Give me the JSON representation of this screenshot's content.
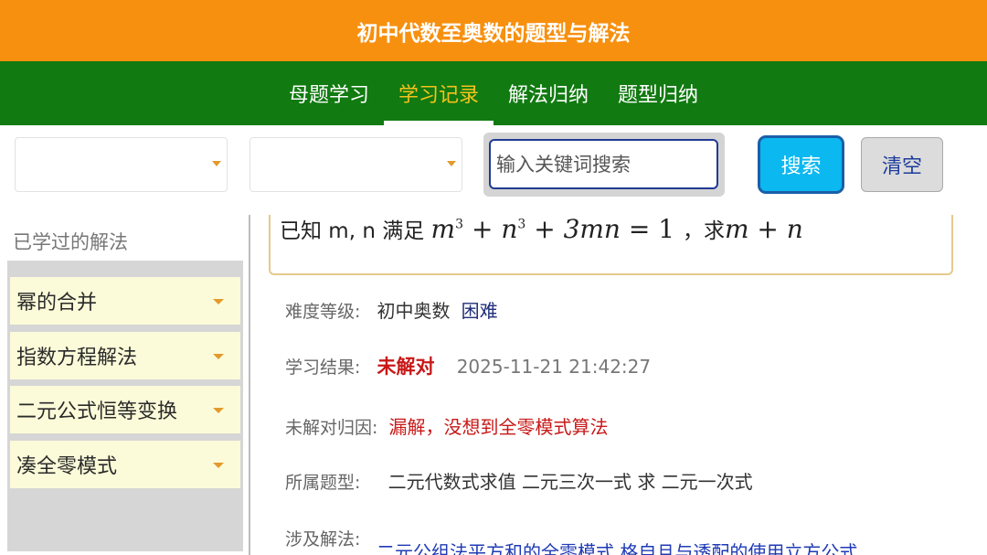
{
  "app": {
    "title": "初中代数至奥数的题型与解法"
  },
  "nav": {
    "tabs": [
      {
        "label": "母题学习"
      },
      {
        "label": "学习记录"
      },
      {
        "label": "解法归纳"
      },
      {
        "label": "题型归纳"
      }
    ],
    "active_index": 1
  },
  "toolbar": {
    "search_placeholder": "输入关键词搜索",
    "search_label": "搜索",
    "clear_label": "清空"
  },
  "sidebar": {
    "title": "已学过的解法",
    "items": [
      {
        "label": "幂的合并"
      },
      {
        "label": "指数方程解法"
      },
      {
        "label": "二元公式恒等变换"
      },
      {
        "label": "凑全零模式"
      }
    ]
  },
  "problem": {
    "prefix": "已知 m, n 满足",
    "suffix": "，求",
    "math_eq": {
      "m": "m",
      "n": "n",
      "exp": "3",
      "plus": "+",
      "coef": "3mn",
      "eq": "=",
      "rhs": "1"
    },
    "math_target": "m + n"
  },
  "details": {
    "difficulty_label": "难度等级:",
    "difficulty_level": "初中奥数",
    "difficulty_value": "困难",
    "result_label": "学习结果:",
    "result_value": "未解对",
    "result_time": "2025-11-21 21:42:27",
    "cause_label": "未解对归因:",
    "cause_value": "漏解，没想到全零模式算法",
    "type_label": "所属题型:",
    "type_value": "二元代数式求值  二元三次一式 求 二元一次式",
    "methods_label": "涉及解法:",
    "methods_value": "二元公组法平方和的全零模式  格自且与透配的使用立方公式"
  },
  "colors": {
    "header_bg": "#f7900f",
    "nav_bg": "#117a11",
    "active_tab": "#f5c21b",
    "search_button": "#0bb8ef",
    "error_text": "#c81818"
  }
}
